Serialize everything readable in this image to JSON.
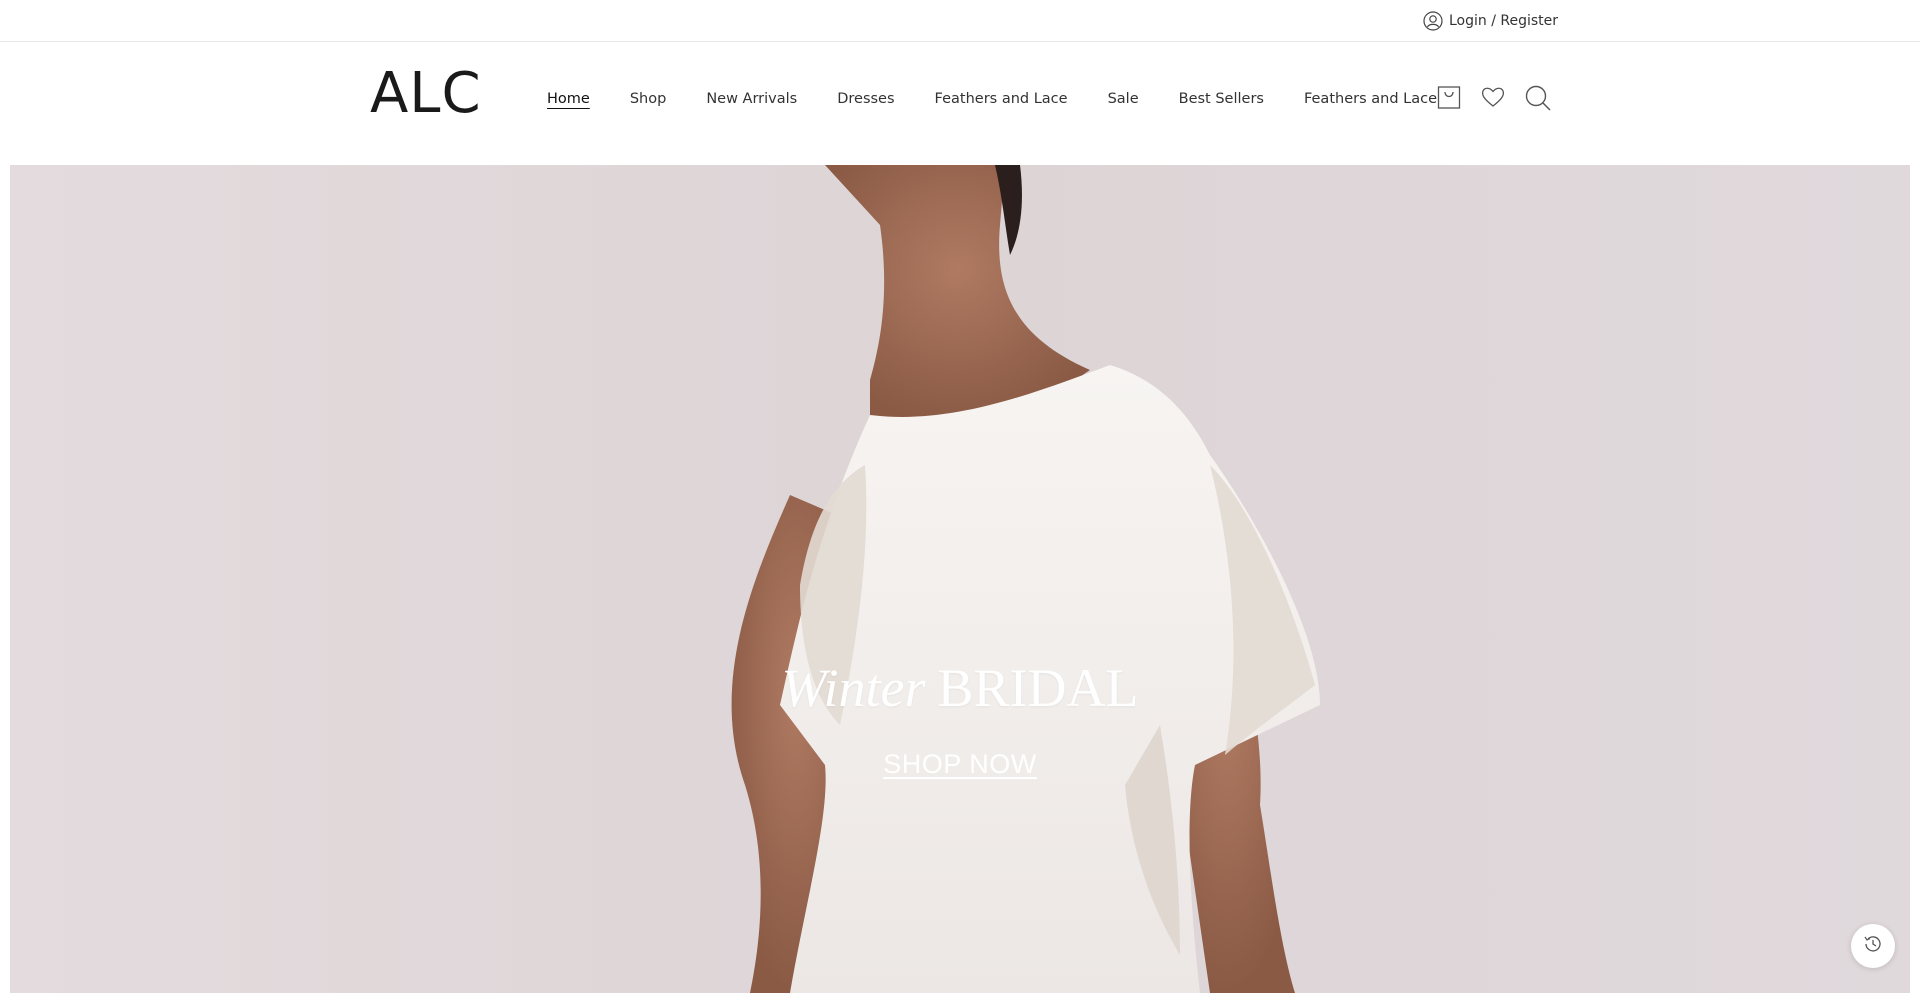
{
  "topbar": {
    "login_label": "Login / Register",
    "user_icon": "user-icon"
  },
  "header": {
    "logo": "ALC",
    "nav": [
      {
        "label": "Home",
        "active": true
      },
      {
        "label": "Shop"
      },
      {
        "label": "New Arrivals"
      },
      {
        "label": "Dresses"
      },
      {
        "label": "Feathers and Lace"
      },
      {
        "label": "Sale"
      },
      {
        "label": "Best Sellers"
      },
      {
        "label": "Feathers and Lace"
      }
    ],
    "icons": [
      "bag-icon",
      "heart-icon",
      "search-icon"
    ]
  },
  "hero": {
    "title_script": "Winter",
    "title_main": "BRIDAL",
    "cta": "SHOP NOW",
    "background_color": "#e2dadc"
  },
  "floating": {
    "history_icon": "clock-history-icon"
  }
}
